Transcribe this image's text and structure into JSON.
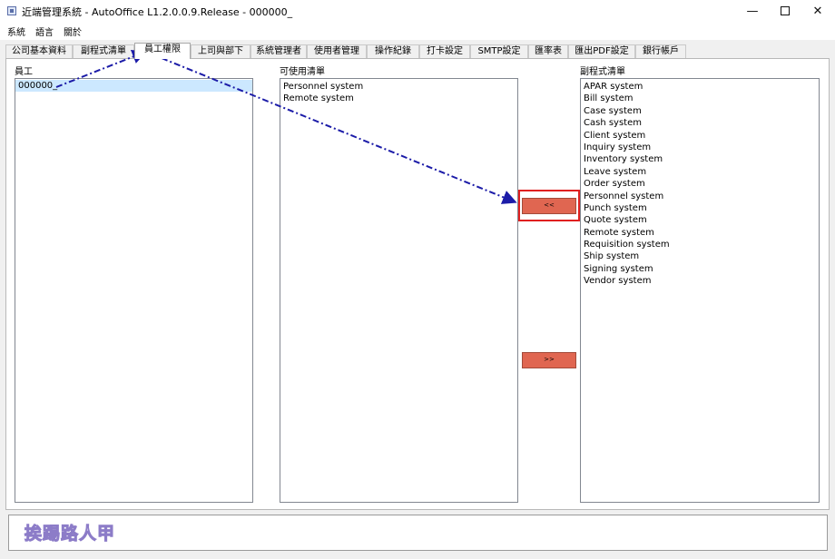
{
  "window": {
    "title": "近端管理系統  -  AutoOffice    L1.2.0.0.9.Release - 000000_",
    "controls": {
      "minimize": "—",
      "close": "✕"
    }
  },
  "menu": [
    "系統",
    "語言",
    "關於"
  ],
  "tabs": [
    {
      "label": "公司基本資料",
      "active": false
    },
    {
      "label": "副程式清單",
      "active": false
    },
    {
      "label": "員工權限",
      "active": true
    },
    {
      "label": "上司與部下",
      "active": false
    },
    {
      "label": "系統管理者",
      "active": false
    },
    {
      "label": "使用者管理",
      "active": false
    },
    {
      "label": "操作紀錄",
      "active": false
    },
    {
      "label": "打卡設定",
      "active": false
    },
    {
      "label": "SMTP設定",
      "active": false
    },
    {
      "label": "匯率表",
      "active": false
    },
    {
      "label": "匯出PDF設定",
      "active": false
    },
    {
      "label": "銀行帳戶",
      "active": false
    }
  ],
  "employees": {
    "label": "員工",
    "items": [
      "000000_"
    ],
    "selected_index": 0
  },
  "available": {
    "label": "可使用清單",
    "items": [
      "Personnel system",
      "Remote system"
    ]
  },
  "programs": {
    "label": "副程式清單",
    "items": [
      "APAR system",
      "Bill system",
      "Case system",
      "Cash system",
      "Client system",
      "Inquiry system",
      "Inventory system",
      "Leave system",
      "Order system",
      "Personnel system",
      "Punch system",
      "Quote system",
      "Remote system",
      "Requisition system",
      "Ship system",
      "Signing system",
      "Vendor system"
    ]
  },
  "buttons": {
    "add": "<<",
    "remove": ">>"
  },
  "watermark": "挨踢路人甲",
  "colors": {
    "button_red": "#e06651",
    "highlight": "#e02020",
    "annotation_arrow": "#1c1ca8",
    "selection": "#cce8ff"
  }
}
